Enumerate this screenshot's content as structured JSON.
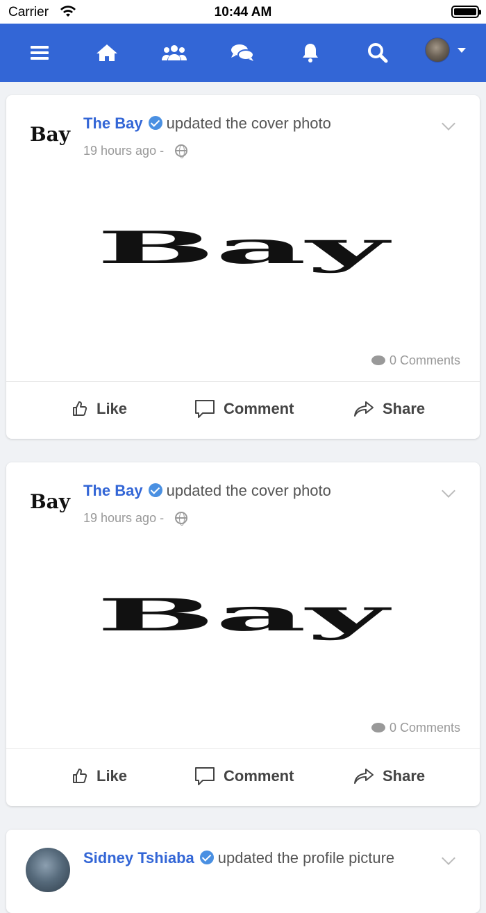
{
  "status_bar": {
    "carrier": "Carrier",
    "time": "10:44 AM"
  },
  "navbar": {
    "icons": [
      "menu-icon",
      "home-icon",
      "groups-icon",
      "messages-icon",
      "notifications-icon",
      "search-icon",
      "avatar"
    ],
    "color": "#3366d6"
  },
  "posts": [
    {
      "logo_text": "Bay",
      "author": "The Bay",
      "action": "updated the cover photo",
      "time": "19 hours ago -",
      "cover_text": "Bay",
      "comments": "0 Comments",
      "like_label": "Like",
      "comment_label": "Comment",
      "share_label": "Share"
    },
    {
      "logo_text": "Bay",
      "author": "The Bay",
      "action": "updated the cover photo",
      "time": "19 hours ago -",
      "cover_text": "Bay",
      "comments": "0 Comments",
      "like_label": "Like",
      "comment_label": "Comment",
      "share_label": "Share"
    },
    {
      "author": "Sidney Tshiaba",
      "action": "updated the profile picture"
    }
  ]
}
